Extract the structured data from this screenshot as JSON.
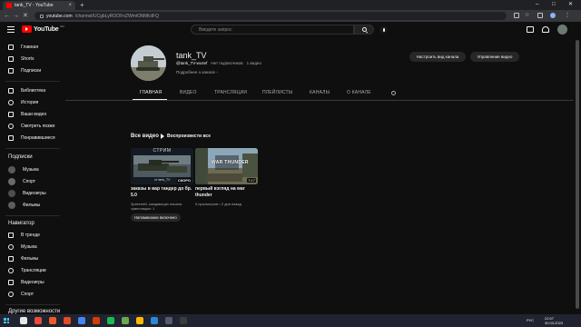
{
  "browser": {
    "tab_title": "tank_TV - YouTube",
    "new_tab": "+",
    "url_host": "youtube.com",
    "url_path": "/channel/UCgbLyROOFnZWmtOMtlKdFQ",
    "window_controls": [
      "–",
      "□",
      "✕"
    ],
    "nav_buttons": [
      "←",
      "→",
      "✕"
    ]
  },
  "header": {
    "logo_text": "YouTube",
    "logo_region": "RU",
    "search_placeholder": "Введите запрос"
  },
  "sidebar": {
    "main": [
      {
        "label": "Главная",
        "icon": "home-icon"
      },
      {
        "label": "Shorts",
        "icon": "shorts-icon"
      },
      {
        "label": "Подписки",
        "icon": "subscriptions-icon"
      }
    ],
    "library": [
      {
        "label": "Библиотека",
        "icon": "library-icon"
      },
      {
        "label": "История",
        "icon": "history-icon"
      },
      {
        "label": "Ваши видео",
        "icon": "your-videos-icon"
      },
      {
        "label": "Смотреть позже",
        "icon": "watch-later-icon"
      },
      {
        "label": "Понравившиеся",
        "icon": "like-icon"
      }
    ],
    "subscriptions_title": "Подписки",
    "subscriptions": [
      {
        "label": "Музыка",
        "color": "#5a5a5a"
      },
      {
        "label": "Спорт",
        "color": "#6b6b6b"
      },
      {
        "label": "Видеоигры",
        "color": "#4e4e4e"
      },
      {
        "label": "Фильмы",
        "color": "#5e5e5e"
      }
    ],
    "navigator_title": "Навигатор",
    "navigator": [
      {
        "label": "В тренде",
        "icon": "trending-icon"
      },
      {
        "label": "Музыка",
        "icon": "music-icon"
      },
      {
        "label": "Фильмы",
        "icon": "movies-icon"
      },
      {
        "label": "Трансляции",
        "icon": "live-icon"
      },
      {
        "label": "Видеоигры",
        "icon": "gaming-icon"
      },
      {
        "label": "Спорт",
        "icon": "sport-icon"
      }
    ],
    "more_title": "Другие возможности"
  },
  "channel": {
    "name": "tank_TV",
    "handle": "@tank_TV-wx4ef",
    "subscribers": "Нет подписчиков",
    "video_count": "1 видео",
    "about_link": "Подробнее о канале",
    "about_arrow": "›",
    "customize_button": "Настроить вид канала",
    "manage_button": "Управление видео"
  },
  "tabs": [
    "ГЛАВНАЯ",
    "ВИДЕО",
    "ТРАНСЛЯЦИИ",
    "ПЛЕЙЛИСТЫ",
    "КАНАЛЫ",
    "О КАНАЛЕ"
  ],
  "videos_section": {
    "title": "Все видео",
    "play_all": "Воспроизвести все",
    "videos": [
      {
        "title": "заказы в вар тандер до бр. 5.0",
        "meta_line1": "Зрителей, ожидающих начала",
        "meta_line2": "трансляции: 1",
        "badge": "СКОРО",
        "thumb_top": "СТРИМ",
        "thumb_bottom": "от tank_TV",
        "notify_button": "Напоминание включено"
      },
      {
        "title": "первый взгляд на war thunder",
        "meta_line1": "0 просмотров • 2 дня назад",
        "duration": "7:17",
        "thumb_logo": "WAR THUNDER"
      }
    ]
  },
  "taskbar": {
    "lang": "РУС",
    "time": "22:07",
    "date": "30.03.2023",
    "apps": [
      "#e8e8e8",
      "#e84c3d",
      "#f05a28",
      "#e34a26",
      "#4285f4",
      "#d83b01",
      "#1db954",
      "#6aa84f",
      "#ffb900",
      "#2b88d8",
      "#555b6e",
      "#3c3c3c"
    ]
  }
}
